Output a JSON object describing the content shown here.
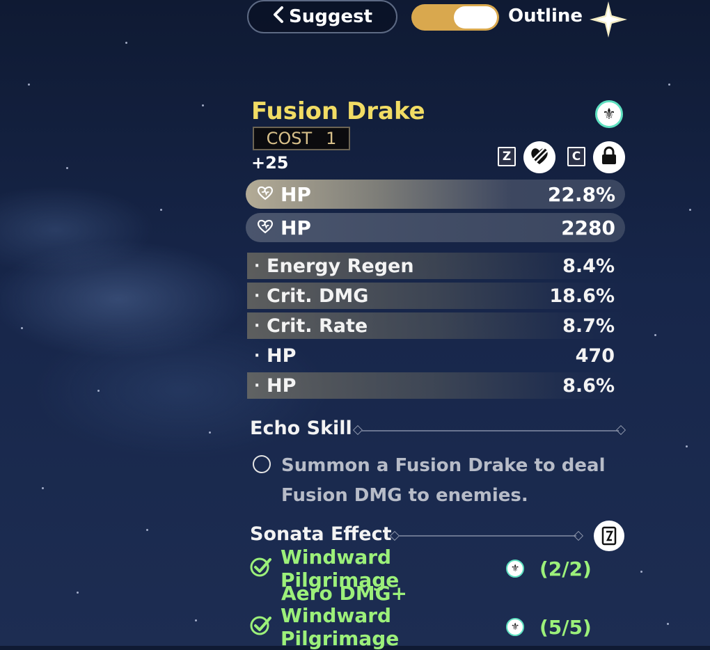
{
  "header": {
    "suggest_label": "Suggest",
    "outline_label": "Outline",
    "outline_toggle_on": true,
    "colors": {
      "toggle_track": "#d9a84e",
      "toggle_knob": "#ffffff"
    }
  },
  "echo": {
    "name": "Fusion Drake",
    "cost_label": "COST",
    "cost_value": "1",
    "level": "+25",
    "element_icon": "fusion-element-icon",
    "name_color": "#f1dc64"
  },
  "actions": {
    "discard_key": "Z",
    "discard_icon": "discard-icon",
    "lock_key": "C",
    "lock_icon": "lock-icon"
  },
  "main_stats": [
    {
      "name": "HP",
      "value": "22.8%",
      "icon": "hp-heart-icon"
    },
    {
      "name": "HP",
      "value": "2280",
      "icon": "hp-heart-icon"
    }
  ],
  "sub_stats": [
    {
      "bullet": "·",
      "name": "Energy Regen",
      "value": "8.4%"
    },
    {
      "bullet": "·",
      "name": "Crit. DMG",
      "value": "18.6%"
    },
    {
      "bullet": "·",
      "name": "Crit. Rate",
      "value": "8.7%"
    },
    {
      "bullet": "·",
      "name": "HP",
      "value": "470"
    },
    {
      "bullet": "·",
      "name": "HP",
      "value": "8.6%"
    }
  ],
  "echo_skill": {
    "title": "Echo Skill",
    "line1": "Summon a Fusion Drake to deal",
    "line2": "Fusion DMG to enemies."
  },
  "sonata": {
    "title": "Sonata Effect",
    "icon": "sonata-card-icon",
    "effects": [
      {
        "name": "Windward Pilgrimage",
        "count": "(2/2)",
        "desc": "Aero DMG+"
      },
      {
        "name": "Windward Pilgrimage",
        "count": "(5/5)",
        "desc": ""
      }
    ],
    "effect_color": "#9cf07a"
  }
}
